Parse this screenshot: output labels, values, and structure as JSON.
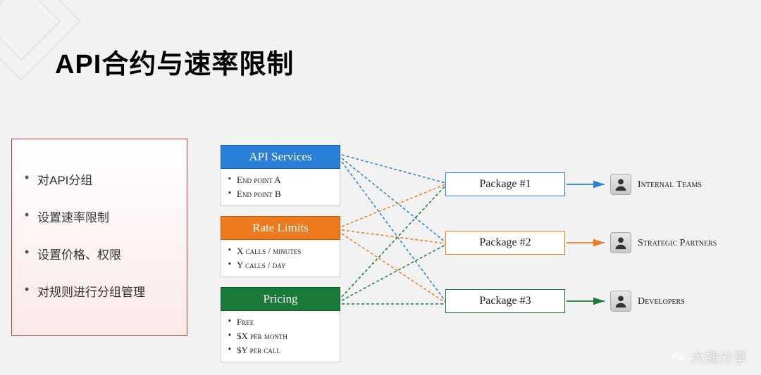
{
  "title": "API合约与速率限制",
  "leftBox": {
    "items": [
      "对API分组",
      "设置速率限制",
      "设置价格、权限",
      "对规则进行分组管理"
    ]
  },
  "cards": {
    "api": {
      "header": "API Services",
      "items": [
        "End point A",
        "End point B"
      ]
    },
    "rate": {
      "header": "Rate Limits",
      "items": [
        "X calls / minutes",
        "Y calls / day"
      ]
    },
    "pricing": {
      "header": "Pricing",
      "items": [
        "Free",
        "$X per month",
        "$Y per call"
      ]
    }
  },
  "packages": {
    "p1": "Package #1",
    "p2": "Package #2",
    "p3": "Package #3"
  },
  "roles": {
    "r1": "Internal Teams",
    "r2": "Strategic Partners",
    "r3": "Developers"
  },
  "watermark": "大魏分享"
}
